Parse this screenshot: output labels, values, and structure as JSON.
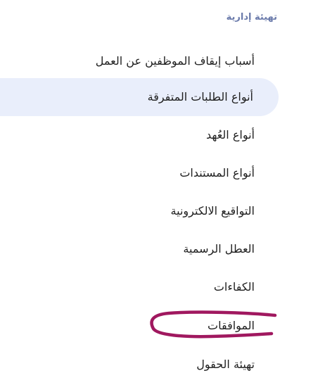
{
  "section": {
    "title": "تهيئة إدارية"
  },
  "menu": {
    "items": [
      {
        "label": "أسباب إيقاف الموظفين عن العمل"
      },
      {
        "label": "أنواع الطلبات المتفرقة",
        "active": true
      },
      {
        "label": "أنواع العُهد"
      },
      {
        "label": "أنواع المستندات"
      },
      {
        "label": "التواقيع الالكترونية"
      },
      {
        "label": "العطل الرسمية"
      },
      {
        "label": "الكفاءات"
      },
      {
        "label": "الموافقات",
        "highlighted": true
      },
      {
        "label": "تهيئة الحقول"
      }
    ]
  },
  "colors": {
    "section_title": "#6b7bab",
    "active_bg": "#e9eefb",
    "text": "#1f1f1f",
    "annotation": "#a0185f"
  }
}
